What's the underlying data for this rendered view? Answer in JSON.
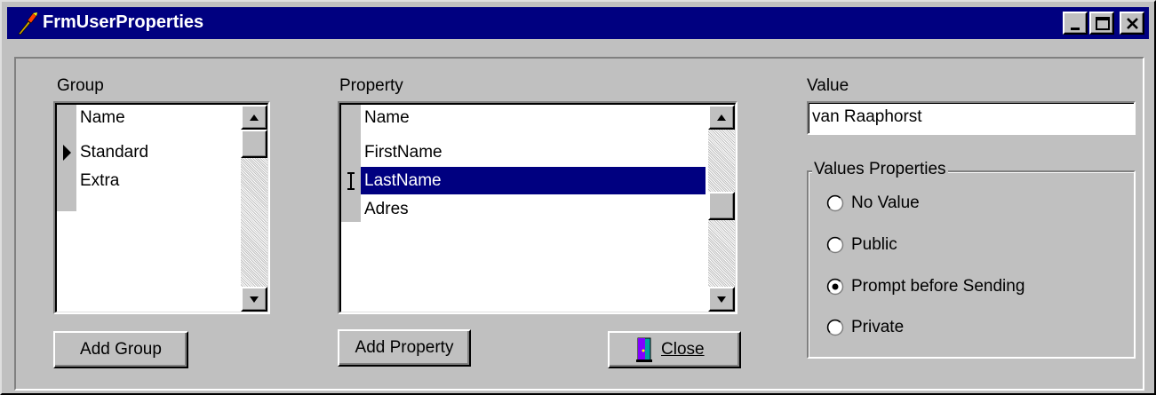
{
  "window": {
    "title": "FrmUserProperties",
    "controls": [
      "minimize-icon",
      "maximize-icon",
      "close-icon"
    ]
  },
  "group_panel": {
    "label": "Group",
    "column_header": "Name",
    "rows": [
      "Standard",
      "Extra"
    ],
    "current_row": "Standard",
    "add_button": "Add Group"
  },
  "property_panel": {
    "label": "Property",
    "column_header": "Name",
    "rows": [
      "FirstName",
      "LastName",
      "Adres"
    ],
    "selected_row": "LastName",
    "add_button": "Add Property"
  },
  "value_panel": {
    "label": "Value",
    "value": "van Raaphorst",
    "group_title": "Values Properties",
    "options": [
      "No Value",
      "Public",
      "Prompt before Sending",
      "Private"
    ],
    "selected_option": "Prompt before Sending"
  },
  "close_button": {
    "label": "Close",
    "icon": "door-exit-icon"
  },
  "colors": {
    "titlebar": "#000080",
    "selection": "#000080",
    "face": "#c0c0c0"
  }
}
